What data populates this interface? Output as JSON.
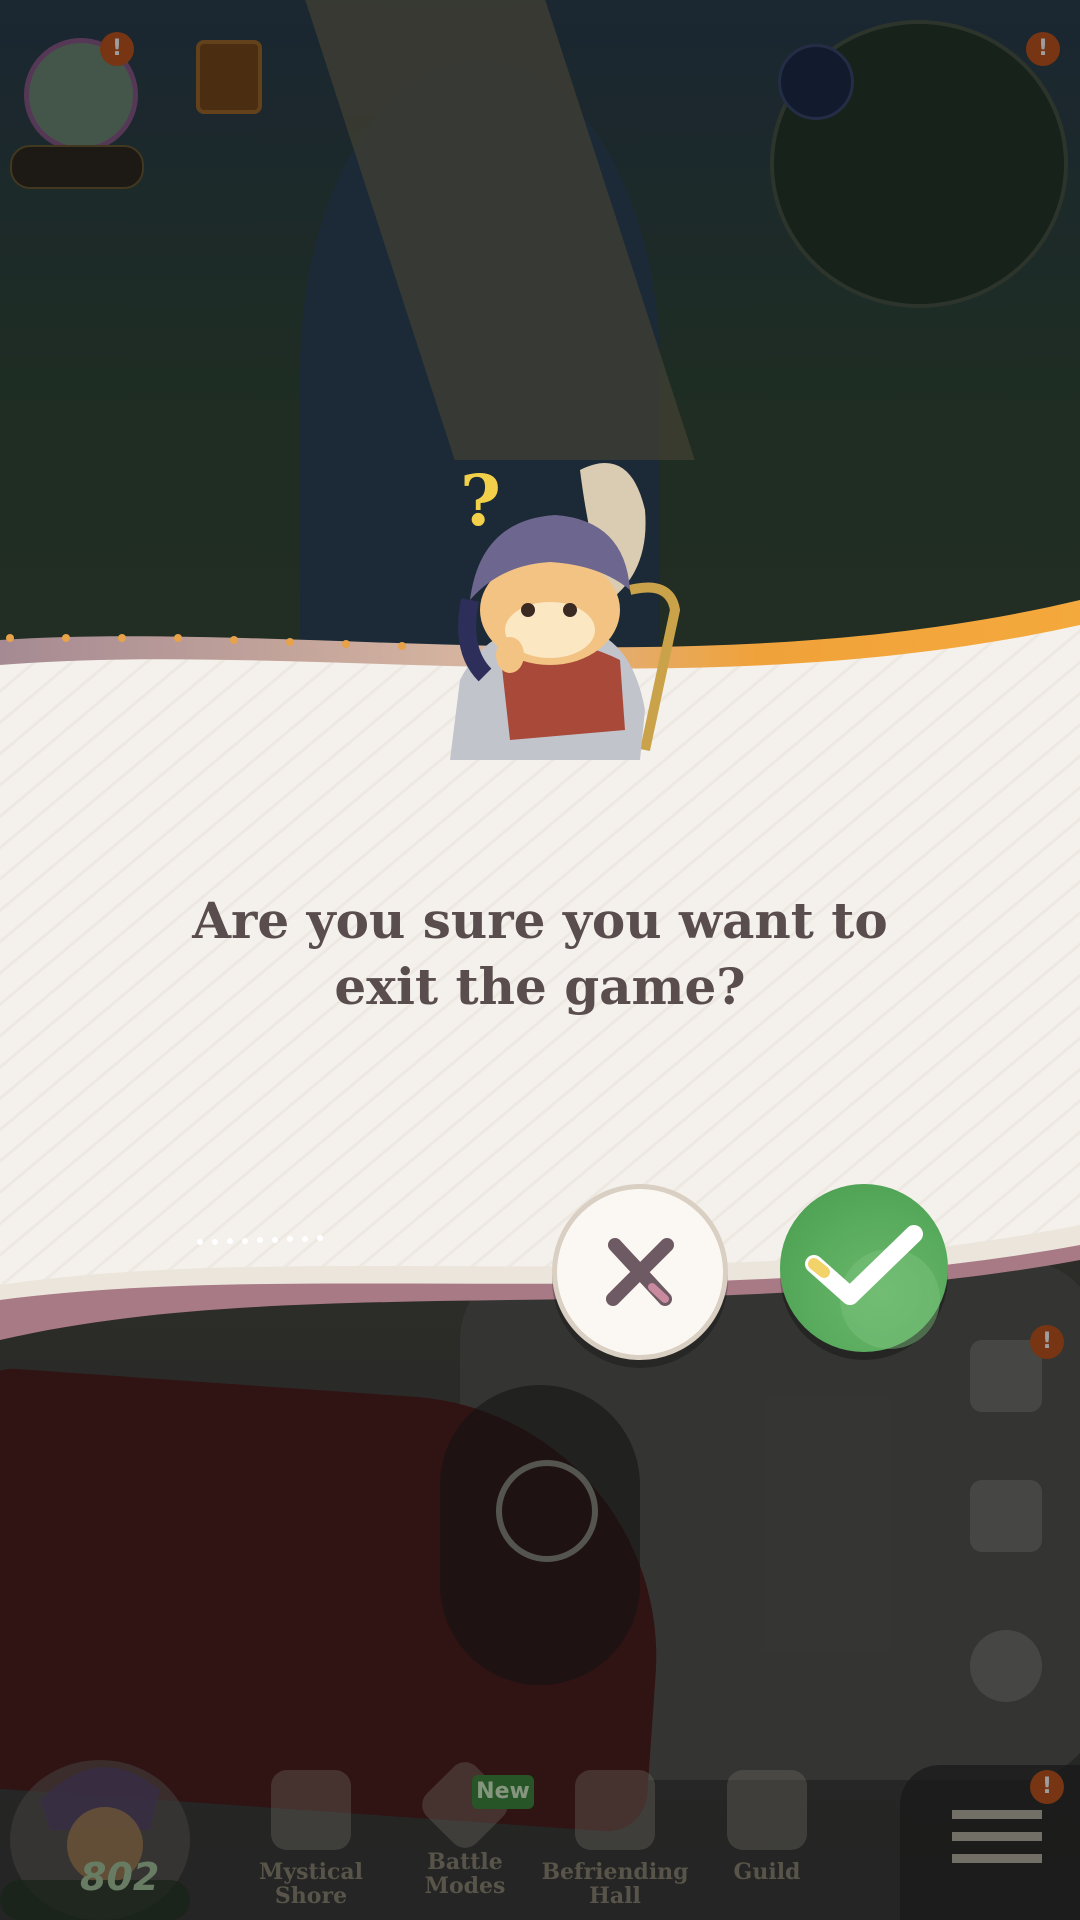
{
  "dialog": {
    "message": "Are you sure you want to exit the game?",
    "cancel_icon": "close-icon",
    "confirm_icon": "check-icon"
  },
  "hud": {
    "avatar_badge": "!",
    "map_badge": "!",
    "side_badge": "!",
    "menu_badge": "!"
  },
  "bottom_nav": {
    "items": [
      {
        "label": "Mystical Shore",
        "icon": "castle-icon"
      },
      {
        "label": "Battle Modes",
        "icon": "cards-icon",
        "tag": "New"
      },
      {
        "label": "Befriending Hall",
        "icon": "horse-icon"
      },
      {
        "label": "Guild",
        "icon": "crossed-swords-icon"
      }
    ]
  },
  "player": {
    "level": "802"
  },
  "colors": {
    "confirm": "#55a85a",
    "dialog_bg": "#f4f1ec",
    "accent_orange": "#f0a23a",
    "text": "#5a4d4d"
  }
}
